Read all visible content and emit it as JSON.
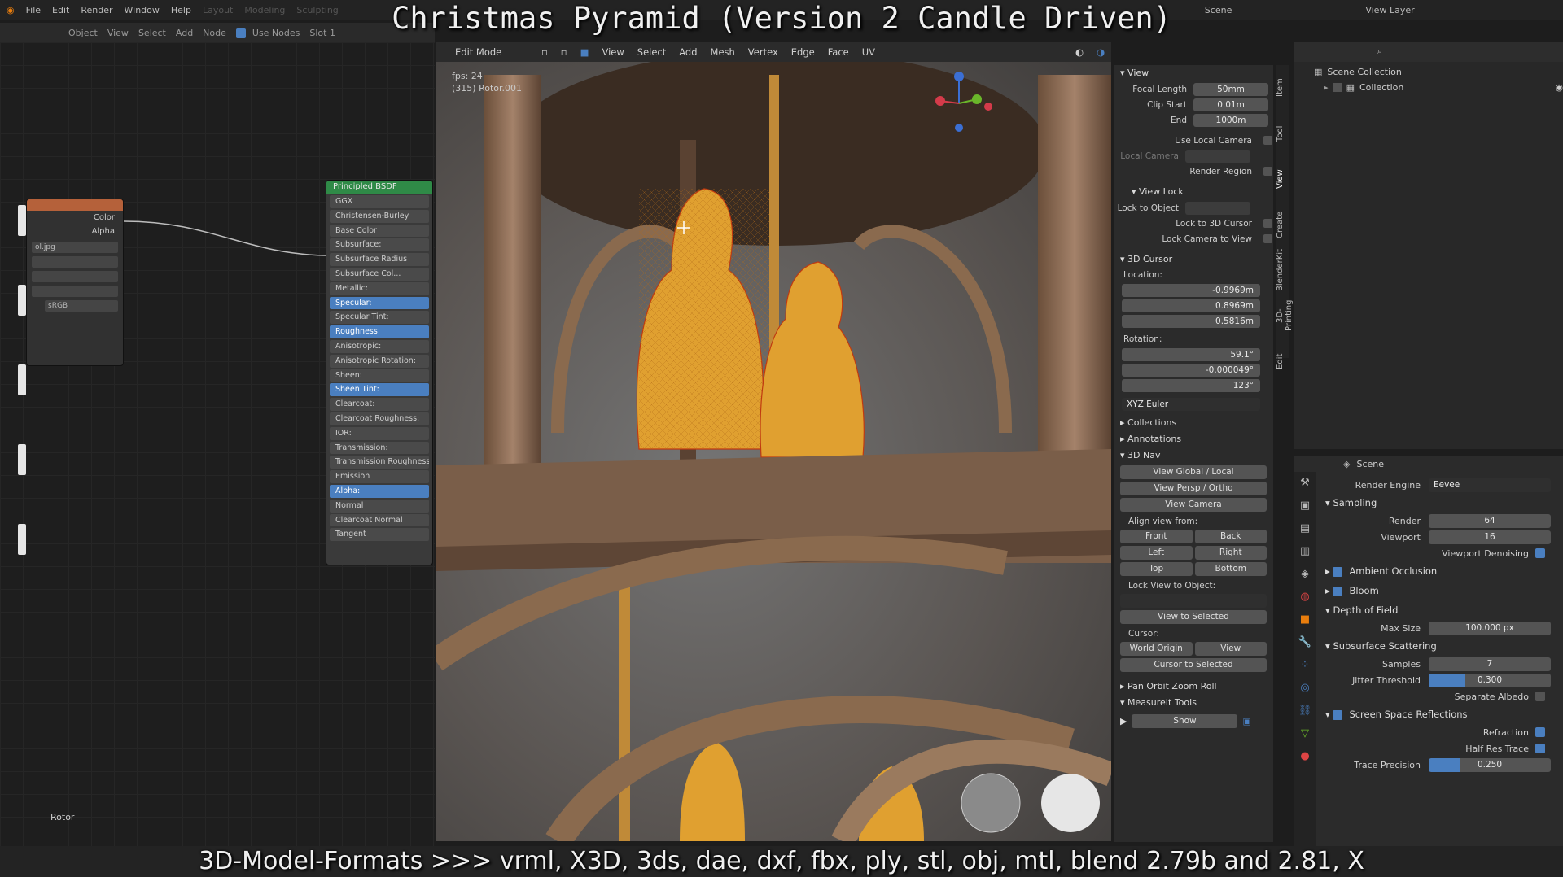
{
  "overlay": {
    "title": "Christmas Pyramid (Version 2 Candle Driven)",
    "footer": "3D-Model-Formats >>> vrml, X3D, 3ds, dae, dxf, fbx, ply, stl, obj, mtl, blend 2.79b and 2.81, X"
  },
  "topbar": {
    "menus": [
      "File",
      "Edit",
      "Render",
      "Window",
      "Help"
    ],
    "workspaces": [
      "Layout",
      "Modeling",
      "Sculpting"
    ],
    "right": [
      "Scene",
      "View Layer"
    ]
  },
  "node_header": {
    "mode": "Object",
    "menus": [
      "View",
      "Select",
      "Add",
      "Node"
    ],
    "use_nodes": "Use Nodes",
    "slot": "Slot 1"
  },
  "texture_node": {
    "out_color": "Color",
    "out_alpha": "Alpha",
    "file": "ol.jpg",
    "colorspace": "sRGB"
  },
  "bsdf_node": {
    "title": "Principled BSDF",
    "inputs": [
      {
        "label": "GGX",
        "hl": false
      },
      {
        "label": "Christensen-Burley",
        "hl": false
      },
      {
        "label": "Base Color",
        "hl": false
      },
      {
        "label": "Subsurface:",
        "hl": false
      },
      {
        "label": "Subsurface Radius",
        "hl": false
      },
      {
        "label": "Subsurface Col...",
        "hl": false
      },
      {
        "label": "Metallic:",
        "hl": false
      },
      {
        "label": "Specular:",
        "hl": true
      },
      {
        "label": "Specular Tint:",
        "hl": false
      },
      {
        "label": "Roughness:",
        "hl": true
      },
      {
        "label": "Anisotropic:",
        "hl": false
      },
      {
        "label": "Anisotropic Rotation:",
        "hl": false
      },
      {
        "label": "Sheen:",
        "hl": false
      },
      {
        "label": "Sheen Tint:",
        "hl": true
      },
      {
        "label": "Clearcoat:",
        "hl": false
      },
      {
        "label": "Clearcoat Roughness:",
        "hl": false
      },
      {
        "label": "IOR:",
        "hl": false
      },
      {
        "label": "Transmission:",
        "hl": false
      },
      {
        "label": "Transmission Roughness",
        "hl": false
      },
      {
        "label": "Emission",
        "hl": false
      },
      {
        "label": "Alpha:",
        "hl": true
      },
      {
        "label": "Normal",
        "hl": false
      },
      {
        "label": "Clearcoat Normal",
        "hl": false
      },
      {
        "label": "Tangent",
        "hl": false
      }
    ]
  },
  "rotor_label": "Rotor",
  "viewport": {
    "mode": "Edit Mode",
    "menus": [
      "View",
      "Select",
      "Add",
      "Mesh",
      "Vertex",
      "Edge",
      "Face",
      "UV"
    ],
    "info_line1": "fps: 24",
    "info_line2": "(315) Rotor.001"
  },
  "npanel": {
    "view_header": "View",
    "focal_length_label": "Focal Length",
    "focal_length": "50mm",
    "clip_start_label": "Clip Start",
    "clip_start": "0.01m",
    "clip_end_label": "End",
    "clip_end": "1000m",
    "use_local_camera": "Use Local Camera",
    "local_camera": "Local Camera",
    "render_region": "Render Region",
    "view_lock": "View Lock",
    "lock_to_object": "Lock to Object",
    "lock_to_cursor": "Lock to 3D Cursor",
    "lock_camera": "Lock Camera to View",
    "cursor_header": "3D Cursor",
    "location": "Location:",
    "loc_x": "-0.9969m",
    "loc_y": "0.8969m",
    "loc_z": "0.5816m",
    "rotation": "Rotation:",
    "rot_x": "59.1°",
    "rot_y": "-0.000049°",
    "rot_z": "123°",
    "rot_mode": "XYZ Euler",
    "collections": "Collections",
    "annotations": "Annotations",
    "nav_header": "3D Nav",
    "view_global_local": "View Global / Local",
    "view_persp_ortho": "View Persp / Ortho",
    "view_camera": "View Camera",
    "align_view_from": "Align view from:",
    "front": "Front",
    "back": "Back",
    "left": "Left",
    "right": "Right",
    "top": "Top",
    "bottom": "Bottom",
    "lock_view_to_object": "Lock View to Object:",
    "view_to_selected": "View to Selected",
    "cursor_label": "Cursor:",
    "world_origin": "World Origin",
    "cursor_view": "View",
    "cursor_to_selected": "Cursor to Selected",
    "pan_orbit": "Pan Orbit Zoom Roll",
    "measureit": "MeasureIt Tools",
    "show": "Show"
  },
  "npanel_tabs": [
    "Item",
    "Tool",
    "View",
    "Create",
    "BlenderKit",
    "3D-Printing",
    "Edit"
  ],
  "outliner": {
    "scene_collection": "Scene Collection",
    "collection": "Collection"
  },
  "props": {
    "scene": "Scene",
    "render_engine_label": "Render Engine",
    "render_engine": "Eevee",
    "sampling": "Sampling",
    "render_label": "Render",
    "render_samples": "64",
    "viewport_label": "Viewport",
    "viewport_samples": "16",
    "viewport_denoising": "Viewport Denoising",
    "ambient_occlusion": "Ambient Occlusion",
    "bloom": "Bloom",
    "depth_of_field": "Depth of Field",
    "max_size_label": "Max Size",
    "max_size": "100.000 px",
    "sss": "Subsurface Scattering",
    "samples_label": "Samples",
    "samples": "7",
    "jitter_label": "Jitter Threshold",
    "jitter": "0.300",
    "jitter_fraction": 0.3,
    "separate_albedo": "Separate Albedo",
    "ssr": "Screen Space Reflections",
    "refraction": "Refraction",
    "half_res": "Half Res Trace",
    "trace_precision_label": "Trace Precision",
    "trace_precision": "0.250",
    "trace_precision_fraction": 0.25
  },
  "colors": {
    "accent": "#4a7fc0",
    "mesh_orange": "#e0a030",
    "wood": "#8a6a4e",
    "bsdf_header": "#2f8a47",
    "tex_header": "#b5613a"
  }
}
